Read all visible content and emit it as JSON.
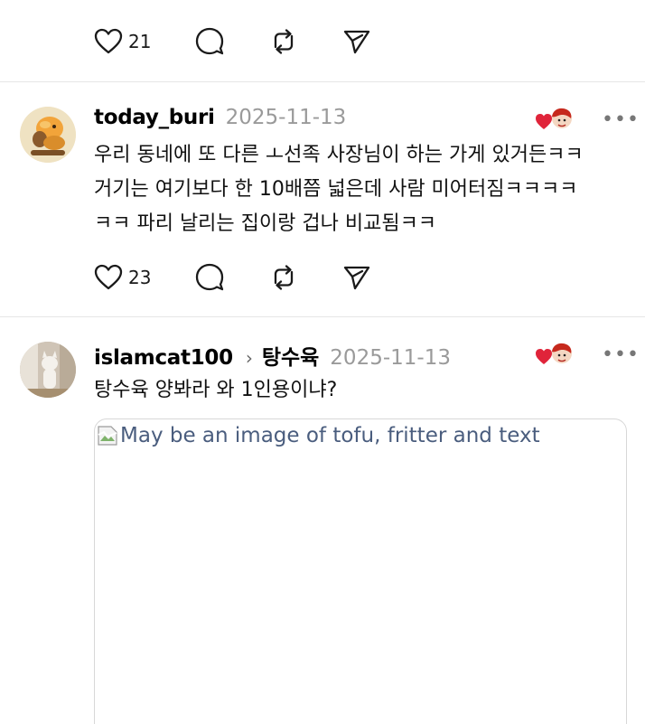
{
  "posts": [
    {
      "likes": "21"
    },
    {
      "username": "today_buri",
      "date": "2025-11-13",
      "lines": [
        "우리 동네에 또 다른 ㅗ선족 사장님이 하는 가게 있거든ㅋㅋ",
        "거기는 여기보다 한 10배쯤 넓은데 사람 미어터짐ㅋㅋㅋㅋ",
        "ㅋㅋ 파리 날리는 집이랑 겁나 비교됨ㅋㅋ"
      ],
      "likes": "23",
      "more": "•••"
    },
    {
      "username": "islamcat100",
      "community": "탕수육",
      "date": "2025-11-13",
      "lines": [
        "탕수육 양봐라 와 1인용이냐?"
      ],
      "image_alt": "May be an image of tofu, fritter and text",
      "more": "•••"
    }
  ],
  "icons": {
    "like": "heart-icon",
    "comment": "comment-bubble-icon",
    "repost": "repost-icon",
    "share": "share-send-icon",
    "more": "more-dots-icon",
    "reaction_badge": "heart-reaction-badge-icon"
  },
  "colors": {
    "date": "#9a9a9a",
    "alt_text": "#4a5d7e",
    "heart_badge": "#e0243a",
    "divider": "#e6e6e6"
  }
}
